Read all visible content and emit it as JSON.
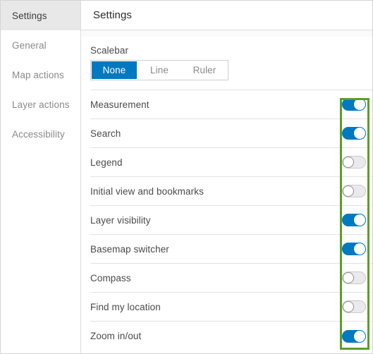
{
  "sidebar": {
    "items": [
      {
        "label": "Settings",
        "active": true
      },
      {
        "label": "General",
        "active": false
      },
      {
        "label": "Map actions",
        "active": false
      },
      {
        "label": "Layer actions",
        "active": false
      },
      {
        "label": "Accessibility",
        "active": false
      }
    ]
  },
  "header": {
    "title": "Settings"
  },
  "scalebar": {
    "label": "Scalebar",
    "options": [
      {
        "label": "None",
        "selected": true
      },
      {
        "label": "Line",
        "selected": false
      },
      {
        "label": "Ruler",
        "selected": false
      }
    ]
  },
  "toggles": [
    {
      "label": "Measurement",
      "state": "on"
    },
    {
      "label": "Search",
      "state": "on"
    },
    {
      "label": "Legend",
      "state": "off"
    },
    {
      "label": "Initial view and bookmarks",
      "state": "off"
    },
    {
      "label": "Layer visibility",
      "state": "on"
    },
    {
      "label": "Basemap switcher",
      "state": "on"
    },
    {
      "label": "Compass",
      "state": "off"
    },
    {
      "label": "Find my location",
      "state": "off"
    },
    {
      "label": "Zoom in/out",
      "state": "on"
    }
  ],
  "colors": {
    "accent_blue": "#0079c1",
    "highlight_green": "#5a9e26",
    "sidebar_active_bg": "#e8e8e8",
    "text_primary": "#4a4a4a",
    "text_muted": "#8a8a8a",
    "border": "#e2e2e2"
  }
}
